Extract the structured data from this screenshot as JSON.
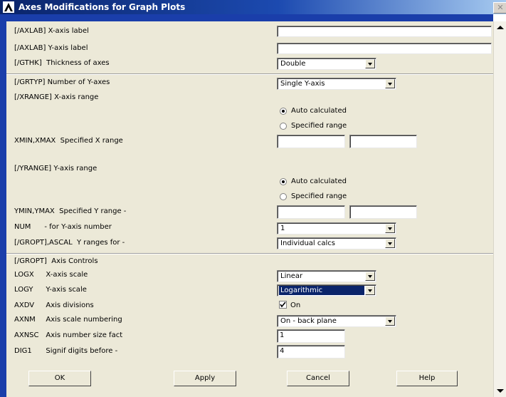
{
  "window": {
    "title": "Axes Modifications for Graph Plots",
    "close_glyph": "✕"
  },
  "fields": {
    "axlab_x": {
      "code": "[/AXLAB]",
      "label": "X-axis label",
      "value": ""
    },
    "axlab_y": {
      "code": "[/AXLAB]",
      "label": "Y-axis label",
      "value": ""
    },
    "gthk": {
      "code": "[/GTHK]",
      "label": "Thickness of axes",
      "value": "Double"
    },
    "grtyp": {
      "code": "[/GRTYP]",
      "label": "Number of Y-axes",
      "value": "Single Y-axis"
    },
    "xrange": {
      "code": "[/XRANGE]",
      "label": "X-axis range",
      "options": [
        "Auto calculated",
        "Specified range"
      ],
      "selected": 0
    },
    "xminmax": {
      "code": "XMIN,XMAX",
      "label": "Specified X range",
      "min": "",
      "max": ""
    },
    "yrange": {
      "code": "[/YRANGE]",
      "label": "Y-axis range",
      "options": [
        "Auto calculated",
        "Specified range"
      ],
      "selected": 0
    },
    "yminmax": {
      "code": "YMIN,YMAX",
      "label": "Specified Y range -",
      "min": "",
      "max": ""
    },
    "num": {
      "code": "NUM",
      "label": "- for Y-axis number",
      "value": "1"
    },
    "gropt_ascal": {
      "code": "[/GROPT],ASCAL",
      "label": "Y ranges for -",
      "value": "Individual calcs"
    },
    "gropt_header": {
      "code": "[/GROPT]",
      "label": "Axis Controls"
    },
    "logx": {
      "code": "LOGX",
      "label": "X-axis scale",
      "value": "Linear"
    },
    "logy": {
      "code": "LOGY",
      "label": "Y-axis scale",
      "value": "Logarithmic"
    },
    "axdv": {
      "code": "AXDV",
      "label": "Axis divisions",
      "checked": true,
      "check_label": "On"
    },
    "axnm": {
      "code": "AXNM",
      "label": "Axis scale numbering",
      "value": "On - back plane"
    },
    "axnsc": {
      "code": "AXNSC",
      "label": "Axis number size fact",
      "value": "1"
    },
    "dig1": {
      "code": "DIG1",
      "label": "Signif digits before -",
      "value": "4"
    }
  },
  "buttons": {
    "ok": "OK",
    "apply": "Apply",
    "cancel": "Cancel",
    "help": "Help"
  },
  "colors": {
    "titlebar": "#0a246a",
    "dialog_bg": "#ece9d8",
    "selection": "#0a246a",
    "frame": "#1a3eaa"
  }
}
